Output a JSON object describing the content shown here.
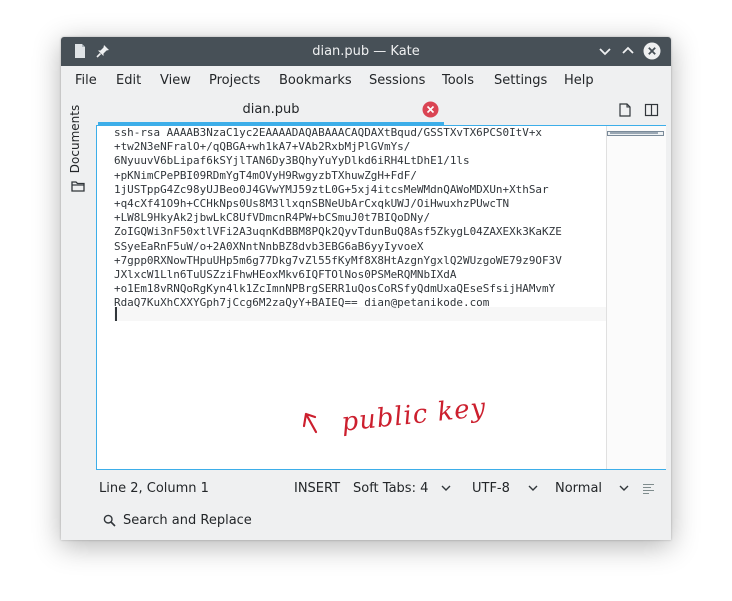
{
  "window": {
    "title": "dian.pub — Kate"
  },
  "menubar": {
    "items": [
      "File",
      "Edit",
      "View",
      "Projects",
      "Bookmarks",
      "Sessions",
      "Tools",
      "Settings",
      "Help"
    ]
  },
  "sidebar": {
    "documents_label": "Documents"
  },
  "tab": {
    "label": "dian.pub"
  },
  "editor": {
    "lines": [
      "ssh-rsa AAAAB3NzaC1yc2EAAAADAQABAAACAQDAXtBqud/GSSTXvTX6PCS0ItV+x",
      "+tw2N3eNFralO+/qQBGA+wh1kA7+VAb2RxbMjPlGVmYs/",
      "6NyuuvV6bLipaf6kSYjlTAN6Dy3BQhyYuYyDlkd6iRH4LtDhE1/1ls",
      "+pKNimCPePBI09RDmYgT4mOVyH9RwgyzbTXhuwZgH+FdF/",
      "1jUSTppG4Zc98yUJBeo0J4GVwYMJ59ztL0G+5xj4itcsMeWMdnQAWoMDXUn+XthSar",
      "+q4cXf41O9h+CCHkNps0Us8M3llxqnSBNeUbArCxqkUWJ/OiHwuxhzPUwcTN",
      "+LW8L9HkyAk2jbwLkC8UfVDmcnR4PW+bCSmuJ0t7BIQoDNy/",
      "ZoIGQWi3nF50xtlVFi2A3uqnKdBBM8PQk2QyvTdunBuQ8Asf5ZkygL04ZAXEXk3KaKZE",
      "SSyeEaRnF5uW/o+2A0XNntNnbBZ8dvb3EBG6aB6yyIyvoeX",
      "+7gpp0RXNowTHpuUHp5m6g77Dkg7vZl55fKyMf8X8HtAzgnYgxlQ2WUzgoWE79z9OF3V",
      "JXlxcW1Lln6TuUSZziFhwHEoxMkv6IQFTOlNos0PSMeRQMNbIXdA",
      "+o1Em18vRNQoRgKyn4lk1ZcImnNPBrgSERR1uQosCoRSfyQdmUxaQEseSfsijHAMvmY",
      "RdaQ7KuXhCXXYGph7jCcg6M2zaQyY+BAIEQ== dian@petanikode.com"
    ]
  },
  "annotation": {
    "text": "public key",
    "color": "#cc1f2e"
  },
  "statusbar": {
    "position": "Line 2, Column 1",
    "mode": "INSERT",
    "indent": "Soft Tabs: 4",
    "encoding": "UTF-8",
    "highlight": "Normal"
  },
  "search": {
    "label": "Search and Replace"
  },
  "colors": {
    "titlebar": "#475057",
    "accent": "#3daee9",
    "close_button": "#da4453"
  }
}
